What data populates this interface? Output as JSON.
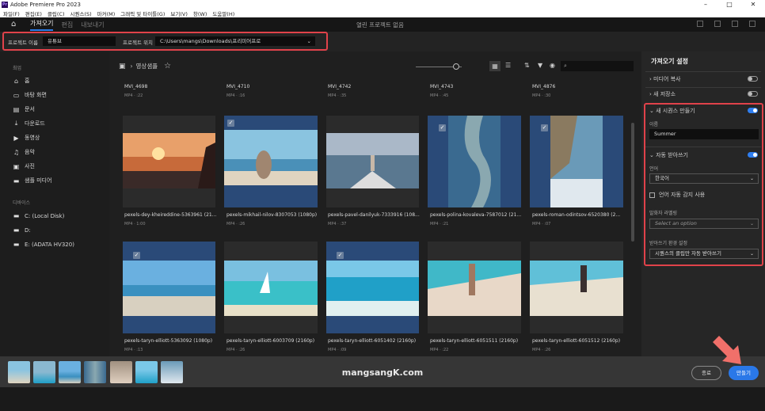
{
  "window": {
    "title": "Adobe Premiere Pro 2023",
    "minimize": "–",
    "maximize": "□",
    "close": "✕"
  },
  "menu": [
    "파일(F)",
    "편집(E)",
    "클립(C)",
    "시퀀스(S)",
    "마커(M)",
    "그래픽 및 타이틀(G)",
    "보기(V)",
    "창(W)",
    "도움말(H)"
  ],
  "tabs": {
    "import": "가져오기",
    "edit": "편집",
    "export": "내보내기",
    "center_title": "열린 프로젝트 없음"
  },
  "project": {
    "name_label": "프로젝트 이름",
    "name_value": "유튜브",
    "location_label": "프로젝트 위치",
    "location_value": "C:\\Users\\mangs\\Downloads\\프리미어프로"
  },
  "sidebar": {
    "recent_header": "최업",
    "items": [
      {
        "icon": "home-icon",
        "label": "홈"
      },
      {
        "icon": "desktop-icon",
        "label": "바탕 화면"
      },
      {
        "icon": "document-icon",
        "label": "문서"
      },
      {
        "icon": "download-icon",
        "label": "다운로드"
      },
      {
        "icon": "video-icon",
        "label": "동영상"
      },
      {
        "icon": "music-icon",
        "label": "음악"
      },
      {
        "icon": "image-icon",
        "label": "사진"
      },
      {
        "icon": "folder-icon",
        "label": "샘플 미디어"
      }
    ],
    "devices_header": "디바이스",
    "devices": [
      {
        "label": "C: (Local Disk)"
      },
      {
        "label": "D:"
      },
      {
        "label": "E: (ADATA HV320)"
      }
    ]
  },
  "browser": {
    "breadcrumb": "영상샘플",
    "breadcrumb_sep": "›",
    "search_placeholder": ""
  },
  "clips_top": [
    {
      "name": "MVI_4698",
      "meta": "MP4 · :22"
    },
    {
      "name": "MVI_4710",
      "meta": "MP4 · :16"
    },
    {
      "name": "MVI_4742",
      "meta": "MP4 · :35"
    },
    {
      "name": "MVI_4743",
      "meta": "MP4 · :45"
    },
    {
      "name": "MVI_4876",
      "meta": "MP4 · :30"
    }
  ],
  "clips_row1": [
    {
      "name": "pexels-dey-kheireddine-5363961 (21...",
      "meta": "MP4 · 1:00",
      "selected": false
    },
    {
      "name": "pexels-mikhail-nilov-8307053 (1080p)",
      "meta": "MP4 · :26",
      "selected": true
    },
    {
      "name": "pexels-pavel-danilyuk-7333916 (108...",
      "meta": "MP4 · :37",
      "selected": false
    },
    {
      "name": "pexels-polina-kovaleva-7587012 (21...",
      "meta": "MP4 · :21",
      "selected": true
    },
    {
      "name": "pexels-roman-odintsov-6520380 (2...",
      "meta": "MP4 · :07",
      "selected": true
    }
  ],
  "clips_row2": [
    {
      "name": "pexels-taryn-elliott-5363092 (1080p)",
      "meta": "MP4 · :13",
      "selected": true
    },
    {
      "name": "pexels-taryn-elliott-6003709 (2160p)",
      "meta": "MP4 · :26",
      "selected": false
    },
    {
      "name": "pexels-taryn-elliott-6051402 (2160p)",
      "meta": "MP4 · :09",
      "selected": true
    },
    {
      "name": "pexels-taryn-elliott-6051511 (2160p)",
      "meta": "MP4 · :22",
      "selected": false
    },
    {
      "name": "pexels-taryn-elliott-6051512 (2160p)",
      "meta": "MP4 · :26",
      "selected": false
    }
  ],
  "settings": {
    "title": "가져오기 설정",
    "media_copy": "미디어 복사",
    "new_bin": "새 저장소",
    "new_sequence": "새 시퀀스 만들기",
    "name_label": "이름",
    "name_value": "Summer",
    "auto_transcribe": "자동 받아쓰기",
    "language_label": "언어",
    "language_value": "한국어",
    "auto_detect": "언어 자동 감지 사용",
    "speaker_label": "발화자 라벨링",
    "speaker_placeholder": "Select an option",
    "transcribe_pref_label": "받아쓰기 환경 설정",
    "transcribe_pref_value": "시퀀스의 클립만 자동 받아쓰기"
  },
  "footer": {
    "watermark": "mangsangK.com",
    "cancel": "종료",
    "create": "만들기"
  },
  "colors": {
    "accent": "#2a78e8",
    "highlight": "#e0424a",
    "selected": "#2a4a78"
  }
}
